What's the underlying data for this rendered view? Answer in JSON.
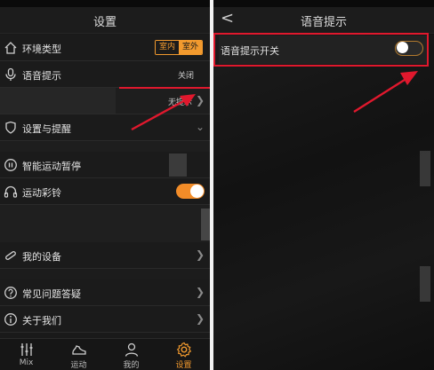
{
  "left": {
    "header": {
      "title": "设置"
    },
    "rows": [
      {
        "id": "env",
        "label": "环境类型",
        "segment": [
          "室内",
          "室外"
        ],
        "active_index": 1
      },
      {
        "id": "voice",
        "label": "语音提示",
        "value": "关闭"
      },
      {
        "id": "hidden",
        "label": "",
        "value": "无提示"
      },
      {
        "id": "goal",
        "label": "设置与提醒"
      },
      {
        "id": "pause",
        "label": "智能运动暂停"
      },
      {
        "id": "ring",
        "label": "运动彩铃"
      },
      {
        "id": "device",
        "label": "我的设备"
      },
      {
        "id": "faq",
        "label": "常见问题答疑"
      },
      {
        "id": "about",
        "label": "关于我们"
      }
    ],
    "tabs": [
      {
        "label": "Mix",
        "icon": "equalizer-icon"
      },
      {
        "label": "运动",
        "icon": "shoe-icon"
      },
      {
        "label": "我的",
        "icon": "person-icon"
      },
      {
        "label": "设置",
        "icon": "gear-icon",
        "active": true
      }
    ]
  },
  "right": {
    "header": {
      "back": "<",
      "title": "语音提示"
    },
    "toggle_row": {
      "label": "语音提示开关",
      "state": "off"
    }
  },
  "colors": {
    "accent": "#f29a2e",
    "highlight": "#e0182d"
  }
}
